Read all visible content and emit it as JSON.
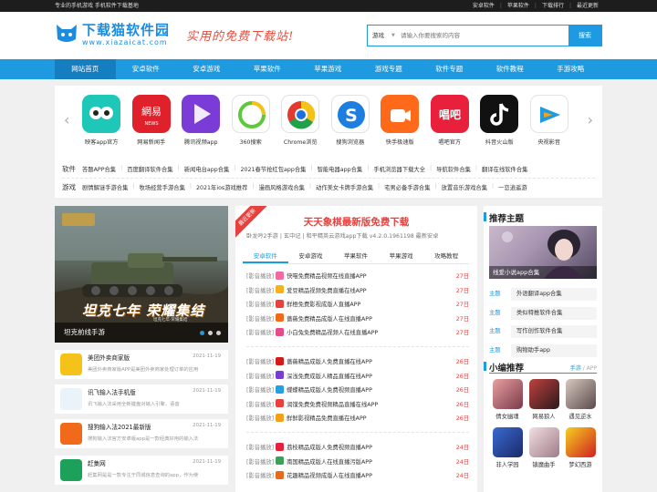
{
  "topbar": {
    "slogan": "专业的手机游戏 手机软件下载基地",
    "links": [
      "安卓软件",
      "苹果软件",
      "下载排行",
      "最近更新"
    ]
  },
  "header": {
    "logo_title": "下载猫软件园",
    "logo_url": "www.xiazaicat.com",
    "slogan_art": "实用的免费下载站!",
    "search": {
      "category": "游戏",
      "placeholder": "请输入你要搜索的内容",
      "button": "搜索"
    }
  },
  "nav": [
    "网站首页",
    "安卓软件",
    "安卓游戏",
    "苹果软件",
    "苹果游戏",
    "游戏专题",
    "软件专题",
    "软件教程",
    "手游攻略"
  ],
  "carousel": {
    "prev": "‹",
    "next": "›",
    "apps": [
      {
        "label": "映客app官方",
        "bg": "#1ec8b8",
        "icon": "owl-icon"
      },
      {
        "label": "网易新闻手",
        "bg": "#e0202a",
        "icon": "netease-news-icon"
      },
      {
        "label": "腾讯视频app",
        "bg": "#7a3bd6",
        "icon": "tencent-video-icon"
      },
      {
        "label": "360搜索",
        "bg": "#ffffff",
        "icon": "360-search-icon"
      },
      {
        "label": "Chrome浏览",
        "bg": "#ffffff",
        "icon": "chrome-icon"
      },
      {
        "label": "搜狗浏览器",
        "bg": "#ffffff",
        "icon": "sogou-browser-icon"
      },
      {
        "label": "快手极速版",
        "bg": "#ff6a1a",
        "icon": "kuaishou-icon"
      },
      {
        "label": "唱吧官方",
        "bg": "#e8203c",
        "icon": "changba-icon"
      },
      {
        "label": "抖音火山版",
        "bg": "#111111",
        "icon": "tiktok-icon"
      },
      {
        "label": "央视影音",
        "bg": "#ffffff",
        "icon": "cctv-video-icon"
      }
    ]
  },
  "categories": {
    "software": {
      "key": "软件",
      "items": [
        "答题APP合集",
        "百度翻译软件合集",
        "新闻电台app合集",
        "2021春节抢红包app合集",
        "智能电器app合集",
        "手机浏览器下载大全",
        "导航软件合集",
        "翻译在线软件合集"
      ]
    },
    "games": {
      "key": "游戏",
      "items": [
        "剧情解谜手游合集",
        "牧场经营手游合集",
        "2021年ios游戏推荐",
        "漫画风格游戏合集",
        "动作美女卡牌手游合集",
        "宅男必备手游合集",
        "放置音乐游戏合集",
        "一恋逍遥游"
      ]
    }
  },
  "hero": {
    "caption": "坦克前线手游",
    "game_title": "坦克七年 荣耀集结",
    "game_sub": "坦克七年·荣耀集结"
  },
  "news": [
    {
      "title": "美团外卖商家版",
      "desc": "美团外卖商家版APP是美团外卖商家处理订单的应用",
      "date": "2021-11-19",
      "color": "#f5c21a"
    },
    {
      "title": "讯飞输入法手机版",
      "desc": "讯飞输入法采用全新键盘对输入引擎，语音",
      "date": "2021-11-19",
      "color": "#eaf2fa"
    },
    {
      "title": "搜狗输入法2021最新版",
      "desc": "搜狗输入法官方安卓版app是一款经典好用的输入法",
      "date": "2021-11-19",
      "color": "#f06a1a"
    },
    {
      "title": "赶集网",
      "desc": "赶集网是是一款专注于同城信息查询的app，作为使",
      "date": "2021-11-19",
      "color": "#1ca05a"
    }
  ],
  "feature": {
    "ribbon": "最近更新",
    "title": "天天象棋最新版免费下载",
    "sub": "卧龙吟2手游 | 玄中记 | 和平精英云游戏app下载 v4.2.0.1961198 最新安卓",
    "tabs": [
      "安卓软件",
      "安卓游戏",
      "苹果软件",
      "苹果游戏",
      "攻略教程"
    ]
  },
  "list_groups": [
    [
      {
        "tag": "[影音播放]",
        "title": "快喵免费精品视频在线直播APP",
        "day": "27日"
      },
      {
        "tag": "[影音播放]",
        "title": "爱豆精品视频免费直播在线APP",
        "day": "27日"
      },
      {
        "tag": "[影音播放]",
        "title": "鲜橙免费影视成版人直播APP",
        "day": "27日"
      },
      {
        "tag": "[影音播放]",
        "title": "蔷薇免费精品成版人在线直播APP",
        "day": "27日"
      },
      {
        "tag": "[影音播放]",
        "title": "小白兔免费精品视频人在线直播APP",
        "day": "27日"
      }
    ],
    [
      {
        "tag": "[影音播放]",
        "title": "蔷薇精品成版人免费直播在线APP",
        "day": "26日"
      },
      {
        "tag": "[影音播放]",
        "title": "深浅免费成版人精品直播在线APP",
        "day": "26日"
      },
      {
        "tag": "[影音播放]",
        "title": "蝶蝶精品成版人免费视频直播APP",
        "day": "26日"
      },
      {
        "tag": "[影音播放]",
        "title": "润馍免费免费视频精品直播在线APP",
        "day": "26日"
      },
      {
        "tag": "[影音播放]",
        "title": "鲜鲜影视精品免费直播在线APP",
        "day": "26日"
      }
    ],
    [
      {
        "tag": "[影音播放]",
        "title": "荔枝精品成版人免费视频直播APP",
        "day": "24日"
      },
      {
        "tag": "[影音播放]",
        "title": "南国精品成版人在线直播污版APP",
        "day": "24日"
      },
      {
        "tag": "[影音播放]",
        "title": "花趣精品视频成版人在线直播APP",
        "day": "24日"
      }
    ]
  ],
  "list_icon_colors": [
    "#f26aa0",
    "#f5b21a",
    "#e8403c",
    "#f06a1a",
    "#e84b8a",
    "#d61a1a",
    "#7a3bd6",
    "#22a0e0",
    "#e8403c",
    "#f5a01a",
    "#e8203c",
    "#3aa05a",
    "#e86a1a"
  ],
  "recommend": {
    "title": "推荐主题",
    "caption": "线爱小说app合集",
    "topics": [
      {
        "k": "主题",
        "v": "外语翻译app合集"
      },
      {
        "k": "主题",
        "v": "类似特推软件合集"
      },
      {
        "k": "主题",
        "v": "写作创作软件合集"
      },
      {
        "k": "主题",
        "v": "购物助手app"
      }
    ]
  },
  "editor": {
    "title": "小编推荐",
    "more_a": "手游",
    "more_sep": "/",
    "more_b": "APP",
    "games": [
      {
        "label": "倩女幽魂",
        "c1": "#e8a0a0",
        "c2": "#7a3a4a"
      },
      {
        "label": "网易狼人",
        "c1": "#c04040",
        "c2": "#2a1a1a"
      },
      {
        "label": "遇见逆水",
        "c1": "#d8c8c0",
        "c2": "#5a4a4a"
      },
      {
        "label": "非人学园",
        "c1": "#3a6ad0",
        "c2": "#1a2a6a"
      },
      {
        "label": "镇魔曲手",
        "c1": "#f0e0e0",
        "c2": "#a07a8a"
      },
      {
        "label": "梦幻西游",
        "c1": "#f5d020",
        "c2": "#d02020"
      }
    ]
  }
}
